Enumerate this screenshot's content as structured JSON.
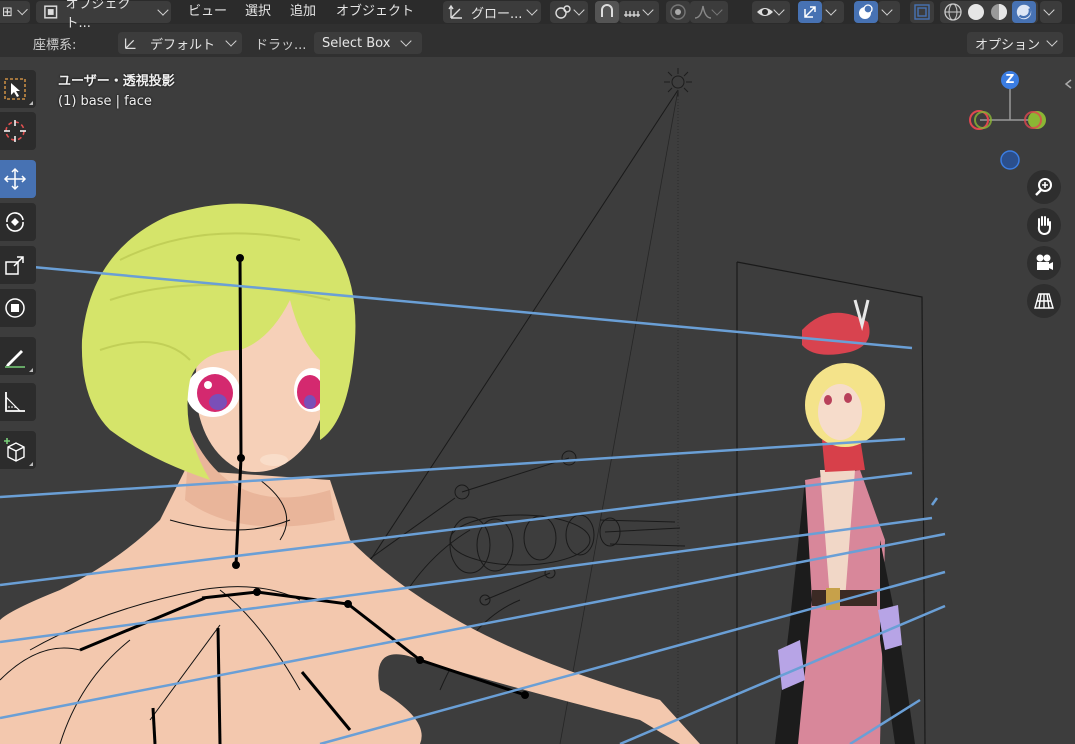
{
  "header": {
    "object_mode_label": "オブジェクト...",
    "menus": [
      "ビュー",
      "選択",
      "追加",
      "オブジェクト"
    ],
    "transform_orientation": "グロー...",
    "icons": [
      "object-mode-icon",
      "transform-pivot-icon",
      "snap-icon",
      "snap-increment-icon",
      "proportional-edit-icon",
      "proportional-falloff-icon",
      "visibility-icon",
      "gizmo-icon",
      "overlay-icon",
      "xray-icon",
      "wireframe-shading-icon",
      "solid-shading-icon",
      "material-shading-icon",
      "rendered-shading-icon"
    ]
  },
  "tool_settings": {
    "coordinate_label": "座標系:",
    "coordinate_value": "デフォルト",
    "drag_label": "ドラッ...",
    "drag_value": "Select Box",
    "options_label": "オプション"
  },
  "viewport": {
    "view_name": "ユーザー・透視投影",
    "object_info": "(1) base | face"
  },
  "toolbar": {
    "tools": [
      "select-box-tool",
      "cursor-tool",
      "move-tool",
      "rotate-tool",
      "scale-tool",
      "transform-tool",
      "annotate-tool",
      "measure-tool",
      "add-cube-tool"
    ],
    "active": "move-tool"
  },
  "gizmo": {
    "axis_z_label": "Z"
  },
  "navigation": [
    "zoom-icon",
    "pan-hand-icon",
    "camera-view-icon",
    "ortho-grid-icon"
  ],
  "colors": {
    "axis_x": "#e0474f",
    "axis_y": "#8bb634",
    "axis_z": "#3b7de2",
    "active_tool": "#4772b3",
    "bone_line": "#6a9fd6",
    "hair": "#d6e76a",
    "skin": "#f3c8ae"
  }
}
